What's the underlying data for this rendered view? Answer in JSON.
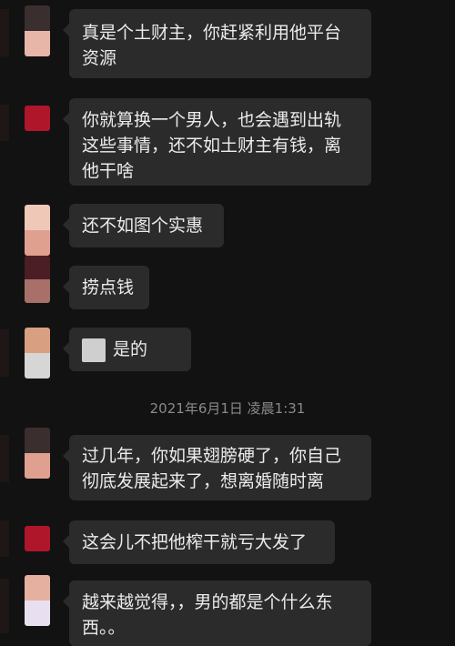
{
  "messages": [
    {
      "text": "真是个土财主，你赶紧利用他平台资源",
      "line1": "真是个土财主，你赶紧利用他平台",
      "line2": "资源"
    },
    {
      "line1": "你就算换一个男人，也会遇到出轨",
      "line2": "这些事情，还不如土财主有钱，离",
      "line3": "他干啥"
    },
    {
      "line1": "还不如图个实惠"
    },
    {
      "line1": "捞点钱"
    },
    {
      "line1": "是的"
    },
    {
      "line1": "过几年，你如果翅膀硬了，你自己",
      "line2": "彻底发展起来了，想离婚随时离"
    },
    {
      "line1": "这会儿不把他榨干就亏大发了"
    },
    {
      "line1": "越来越觉得，，男的都是个什么东",
      "line2": "西。。"
    }
  ],
  "timestamp": "2021年6月1日 凌晨1:31",
  "colors": {
    "background": "#121212",
    "bubble": "#2b2b2b",
    "text": "#ececec",
    "timestamp": "#8a8a8a"
  }
}
